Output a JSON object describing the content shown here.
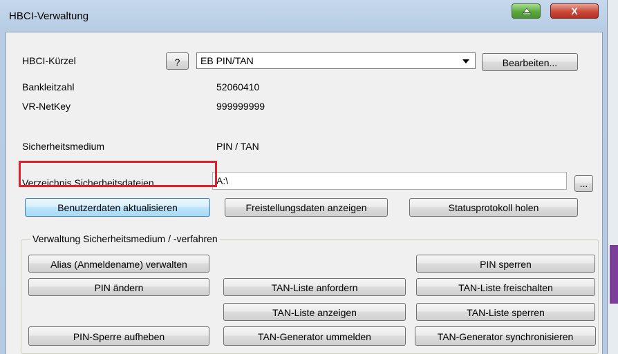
{
  "window": {
    "title": "HBCI-Verwaltung",
    "close_glyph": "X"
  },
  "form": {
    "hbci_label": "HBCI-Kürzel",
    "help_button": "?",
    "hbci_value": "EB PIN/TAN",
    "edit_button": "Bearbeiten...",
    "blz_label": "Bankleitzahl",
    "blz_value": "52060410",
    "netkey_label": "VR-NetKey",
    "netkey_value": "999999999",
    "medium_label": "Sicherheitsmedium",
    "medium_value": "PIN / TAN",
    "dir_label": "Verzeichnis Sicherheitsdateien",
    "dir_value": "A:\\",
    "browse_button": "..."
  },
  "actions": {
    "update_user_data": "Benutzerdaten aktualisieren",
    "show_release_data": "Freistellungsdaten anzeigen",
    "fetch_status_log": "Statusprotokoll holen"
  },
  "group": {
    "title": "Verwaltung Sicherheitsmedium / -verfahren",
    "alias": "Alias (Anmeldename) verwalten",
    "pin_lock": "PIN sperren",
    "pin_change": "PIN ändern",
    "tan_request": "TAN-Liste anfordern",
    "tan_unlock": "TAN-Liste freischalten",
    "tan_show": "TAN-Liste anzeigen",
    "tan_lock": "TAN-Liste sperren",
    "pin_unblock": "PIN-Sperre aufheben",
    "tan_gen_reregister": "TAN-Generator ummelden",
    "tan_gen_sync": "TAN-Generator synchronisieren"
  },
  "colors": {
    "highlight_box": "#e1202a",
    "window_frame": "#b8cde4",
    "client_bg": "#f0f0f0"
  }
}
